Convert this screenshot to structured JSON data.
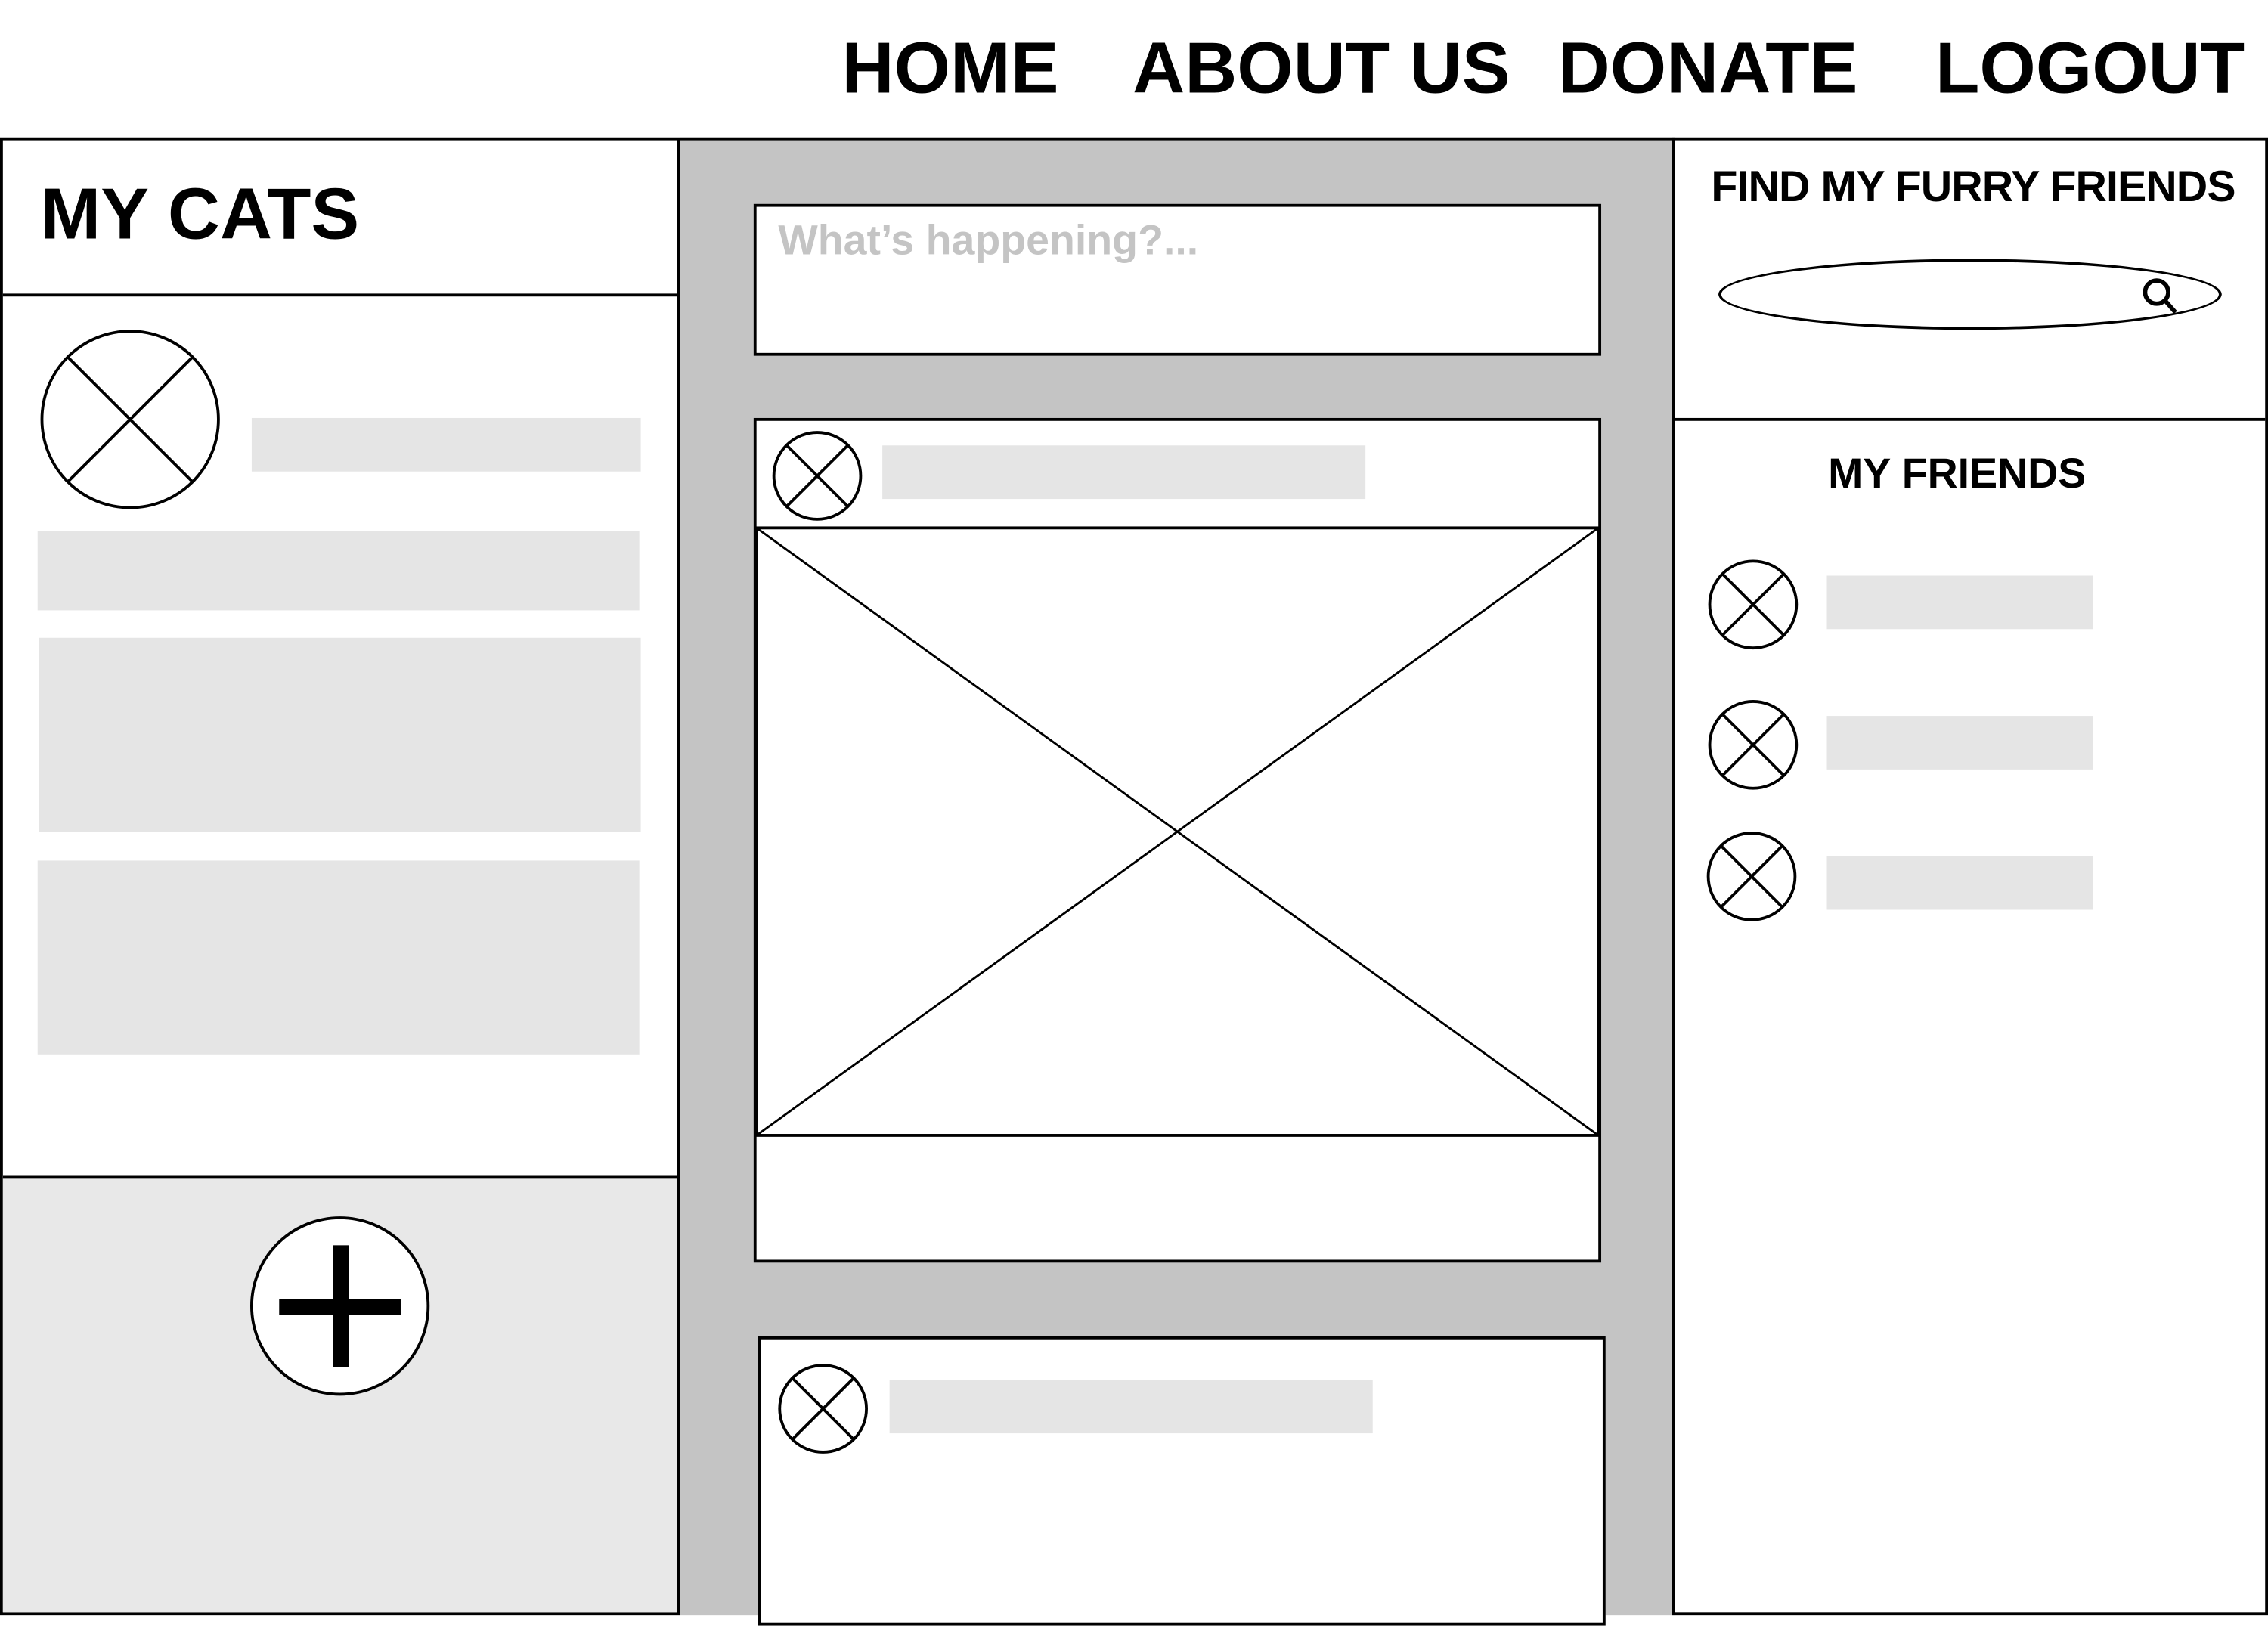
{
  "nav": {
    "items": [
      {
        "label": "HOME"
      },
      {
        "label": "ABOUT US"
      },
      {
        "label": "DONATE"
      },
      {
        "label": "LOGOUT"
      }
    ]
  },
  "left_panel": {
    "title": "MY CATS",
    "add_icon": "plus-icon"
  },
  "feed": {
    "composer_placeholder": "What’s happening?..."
  },
  "right_panel": {
    "search_title": "FIND MY FURRY FRIENDS",
    "search_icon": "search-icon",
    "friends_title": "MY FRIENDS"
  },
  "colors": {
    "feed_background": "#c4c4c4",
    "placeholder_bar": "#e5e5e5",
    "add_section": "#e8e8e8",
    "placeholder_text": "#c4c4c4"
  }
}
